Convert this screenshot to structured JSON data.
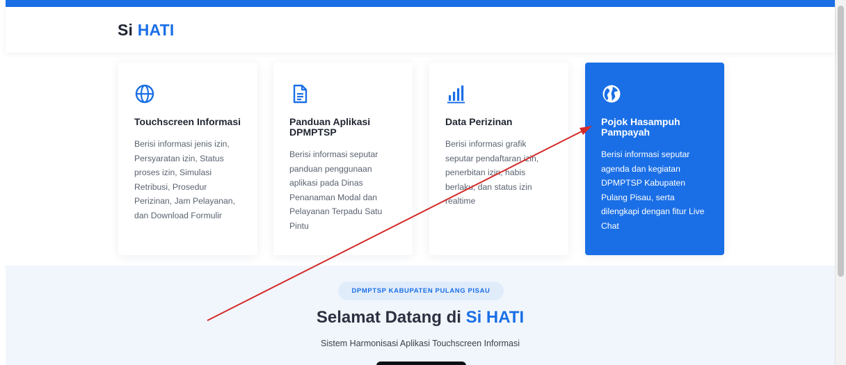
{
  "header": {
    "brand_prefix": "Si",
    "brand_accent": "HATI"
  },
  "cards": [
    {
      "icon": "globe-outline-icon",
      "title": "Touchscreen Informasi",
      "description": "Berisi informasi jenis izin, Persyaratan izin, Status proses izin, Simulasi Retribusi, Prosedur Perizinan, Jam Pelayanan, dan Download Formulir"
    },
    {
      "icon": "document-icon",
      "title": "Panduan Aplikasi DPMPTSP",
      "description": "Berisi informasi seputar panduan penggunaan aplikasi pada Dinas Penanaman Modal dan Pelayanan Terpadu Satu Pintu"
    },
    {
      "icon": "bar-chart-icon",
      "title": "Data Perizinan",
      "description": "Berisi informasi grafik seputar pendaftaran izin, penerbitan izin, habis berlaku, dan status izin realtime"
    },
    {
      "icon": "globe-filled-icon",
      "title": "Pojok Hasampuh Pampayah",
      "description": "Berisi informasi seputar agenda dan kegiatan DPMPTSP Kabupaten Pulang Pisau, serta dilengkapi dengan fitur Live Chat"
    }
  ],
  "welcome": {
    "badge": "DPMPTSP KABUPATEN PULANG PISAU",
    "title_prefix": "Selamat Datang di",
    "title_accent": "Si HATI",
    "subtitle": "Sistem Harmonisasi Aplikasi Touchscreen Informasi"
  },
  "colors": {
    "accent": "#1a6fe6",
    "top_bar": "#1a6fe6",
    "lower_background": "#f1f6fc",
    "annotation_arrow": "#d42a2a"
  }
}
